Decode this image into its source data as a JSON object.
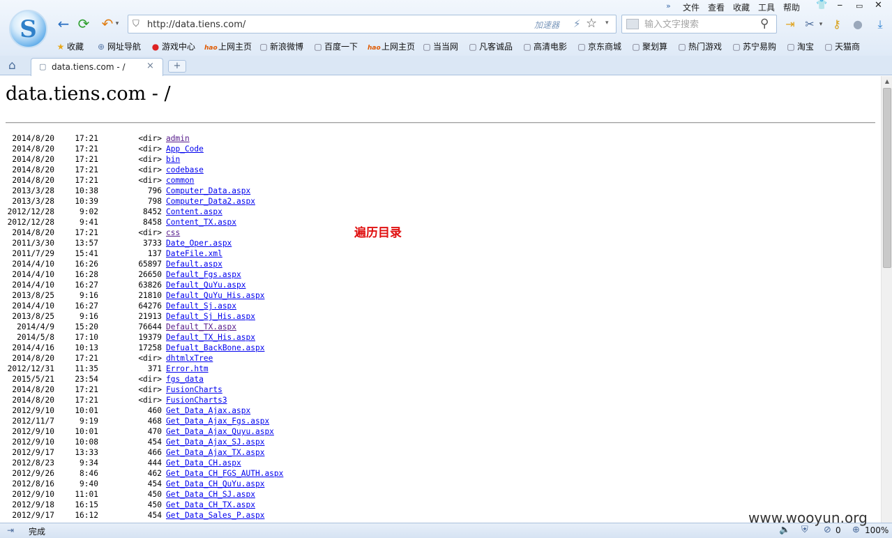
{
  "menu": {
    "more": "»",
    "items": [
      "文件",
      "查看",
      "收藏",
      "工具",
      "帮助"
    ],
    "skin": "👕",
    "minimize": "⎯",
    "maximize": "▭",
    "close": "✕"
  },
  "toolbar": {
    "logo_letter": "S",
    "back": "←",
    "refresh": "⟳",
    "undo": "↶",
    "dropdown": "▾",
    "address": "http://data.tiens.com/",
    "accelerator": "加速器",
    "bolt": "⚡",
    "star": "☆",
    "search_placeholder": "输入文字搜索",
    "search_glyph": "⚲",
    "login_glyph": "⇥",
    "scissors_glyph": "✂",
    "key_glyph": "⚷",
    "more_glyph": "●",
    "download_glyph": "⤓"
  },
  "bookmarks": [
    {
      "icon": "★",
      "label": "收藏"
    },
    {
      "icon": "⊕",
      "label": "网址导航"
    },
    {
      "icon": "●",
      "label": "游戏中心"
    },
    {
      "icon": "hao",
      "label": "上网主页"
    },
    {
      "icon": "▢",
      "label": "新浪微博"
    },
    {
      "icon": "▢",
      "label": "百度一下"
    },
    {
      "icon": "hao",
      "label": "上网主页"
    },
    {
      "icon": "▢",
      "label": "当当网"
    },
    {
      "icon": "▢",
      "label": "凡客诚品"
    },
    {
      "icon": "▢",
      "label": "高清电影"
    },
    {
      "icon": "▢",
      "label": "京东商城"
    },
    {
      "icon": "▢",
      "label": "聚划算"
    },
    {
      "icon": "▢",
      "label": "热门游戏"
    },
    {
      "icon": "▢",
      "label": "苏宁易购"
    },
    {
      "icon": "▢",
      "label": "淘宝"
    },
    {
      "icon": "▢",
      "label": "天猫商"
    }
  ],
  "tabs": {
    "home": "⌂",
    "page_icon": "▢",
    "active_title": "data.tiens.com - /",
    "close": "×",
    "new_tab": "+"
  },
  "page": {
    "heading": "data.tiens.com - /",
    "annotation": "遍历目录",
    "listing": [
      {
        "date": "2014/8/20",
        "time": "17:21",
        "size": "<dir>",
        "name": "admin",
        "visited": true
      },
      {
        "date": "2014/8/20",
        "time": "17:21",
        "size": "<dir>",
        "name": "App_Code",
        "visited": false
      },
      {
        "date": "2014/8/20",
        "time": "17:21",
        "size": "<dir>",
        "name": "bin",
        "visited": false
      },
      {
        "date": "2014/8/20",
        "time": "17:21",
        "size": "<dir>",
        "name": "codebase",
        "visited": false
      },
      {
        "date": "2014/8/20",
        "time": "17:21",
        "size": "<dir>",
        "name": "common",
        "visited": false
      },
      {
        "date": "2013/3/28",
        "time": "10:38",
        "size": "796",
        "name": "Computer_Data.aspx",
        "visited": false
      },
      {
        "date": "2013/3/28",
        "time": "10:39",
        "size": "798",
        "name": "Computer_Data2.aspx",
        "visited": false
      },
      {
        "date": "2012/12/28",
        "time": "9:02",
        "size": "8452",
        "name": "Content.aspx",
        "visited": false
      },
      {
        "date": "2012/12/28",
        "time": "9:41",
        "size": "8458",
        "name": "Content_TX.aspx",
        "visited": false
      },
      {
        "date": "2014/8/20",
        "time": "17:21",
        "size": "<dir>",
        "name": "css",
        "visited": true
      },
      {
        "date": "2011/3/30",
        "time": "13:57",
        "size": "3733",
        "name": "Date_Oper.aspx",
        "visited": false
      },
      {
        "date": "2011/7/29",
        "time": "15:41",
        "size": "137",
        "name": "DateFile.xml",
        "visited": false
      },
      {
        "date": "2014/4/10",
        "time": "16:26",
        "size": "65897",
        "name": "Default.aspx",
        "visited": false
      },
      {
        "date": "2014/4/10",
        "time": "16:28",
        "size": "26650",
        "name": "Default_Fgs.aspx",
        "visited": false
      },
      {
        "date": "2014/4/10",
        "time": "16:27",
        "size": "63826",
        "name": "Default_QuYu.aspx",
        "visited": false
      },
      {
        "date": "2013/8/25",
        "time": "9:16",
        "size": "21810",
        "name": "Default_QuYu_His.aspx",
        "visited": false
      },
      {
        "date": "2014/4/10",
        "time": "16:27",
        "size": "64276",
        "name": "Default_Sj.aspx",
        "visited": false
      },
      {
        "date": "2013/8/25",
        "time": "9:16",
        "size": "21913",
        "name": "Default_Sj_His.aspx",
        "visited": false
      },
      {
        "date": "2014/4/9",
        "time": "15:20",
        "size": "76644",
        "name": "Default_TX.aspx",
        "visited": true
      },
      {
        "date": "2014/5/8",
        "time": "17:10",
        "size": "19379",
        "name": "Default_TX_His.aspx",
        "visited": false
      },
      {
        "date": "2014/4/16",
        "time": "10:13",
        "size": "17258",
        "name": "Defualt_BackBone.aspx",
        "visited": false
      },
      {
        "date": "2014/8/20",
        "time": "17:21",
        "size": "<dir>",
        "name": "dhtmlxTree",
        "visited": false
      },
      {
        "date": "2012/12/31",
        "time": "11:35",
        "size": "371",
        "name": "Error.htm",
        "visited": false
      },
      {
        "date": "2015/5/21",
        "time": "23:54",
        "size": "<dir>",
        "name": "fgs_data",
        "visited": false
      },
      {
        "date": "2014/8/20",
        "time": "17:21",
        "size": "<dir>",
        "name": "FusionCharts",
        "visited": false
      },
      {
        "date": "2014/8/20",
        "time": "17:21",
        "size": "<dir>",
        "name": "FusionCharts3",
        "visited": false
      },
      {
        "date": "2012/9/10",
        "time": "10:01",
        "size": "460",
        "name": "Get_Data_Ajax.aspx",
        "visited": false
      },
      {
        "date": "2012/11/7",
        "time": "9:19",
        "size": "468",
        "name": "Get_Data_Ajax_Fgs.aspx",
        "visited": false
      },
      {
        "date": "2012/9/10",
        "time": "10:01",
        "size": "470",
        "name": "Get_Data_Ajax_Quyu.aspx",
        "visited": false
      },
      {
        "date": "2012/9/10",
        "time": "10:08",
        "size": "454",
        "name": "Get_Data_Ajax_SJ.aspx",
        "visited": false
      },
      {
        "date": "2012/9/17",
        "time": "13:33",
        "size": "466",
        "name": "Get_Data_Ajax_TX.aspx",
        "visited": false
      },
      {
        "date": "2012/8/23",
        "time": "9:34",
        "size": "444",
        "name": "Get_Data_CH.aspx",
        "visited": false
      },
      {
        "date": "2012/9/26",
        "time": "8:46",
        "size": "462",
        "name": "Get_Data_CH_FGS_AUTH.aspx",
        "visited": false
      },
      {
        "date": "2012/8/16",
        "time": "9:40",
        "size": "454",
        "name": "Get_Data_CH_QuYu.aspx",
        "visited": false
      },
      {
        "date": "2012/9/10",
        "time": "11:01",
        "size": "450",
        "name": "Get_Data_CH_SJ.aspx",
        "visited": false
      },
      {
        "date": "2012/9/18",
        "time": "16:15",
        "size": "450",
        "name": "Get_Data_CH_TX.aspx",
        "visited": false
      },
      {
        "date": "2012/9/17",
        "time": "16:12",
        "size": "454",
        "name": "Get_Data_Sales_P.aspx",
        "visited": false
      }
    ]
  },
  "statusbar": {
    "toggle": "⇥",
    "text": "完成",
    "watermark": "www.wooyun.org",
    "speaker": "🔈",
    "security": "⛨",
    "adblock": "⊘",
    "adblock_count": "0",
    "zoom_icon": "⊕",
    "zoom": "100%"
  },
  "scrollbar": {
    "up": "▲"
  }
}
